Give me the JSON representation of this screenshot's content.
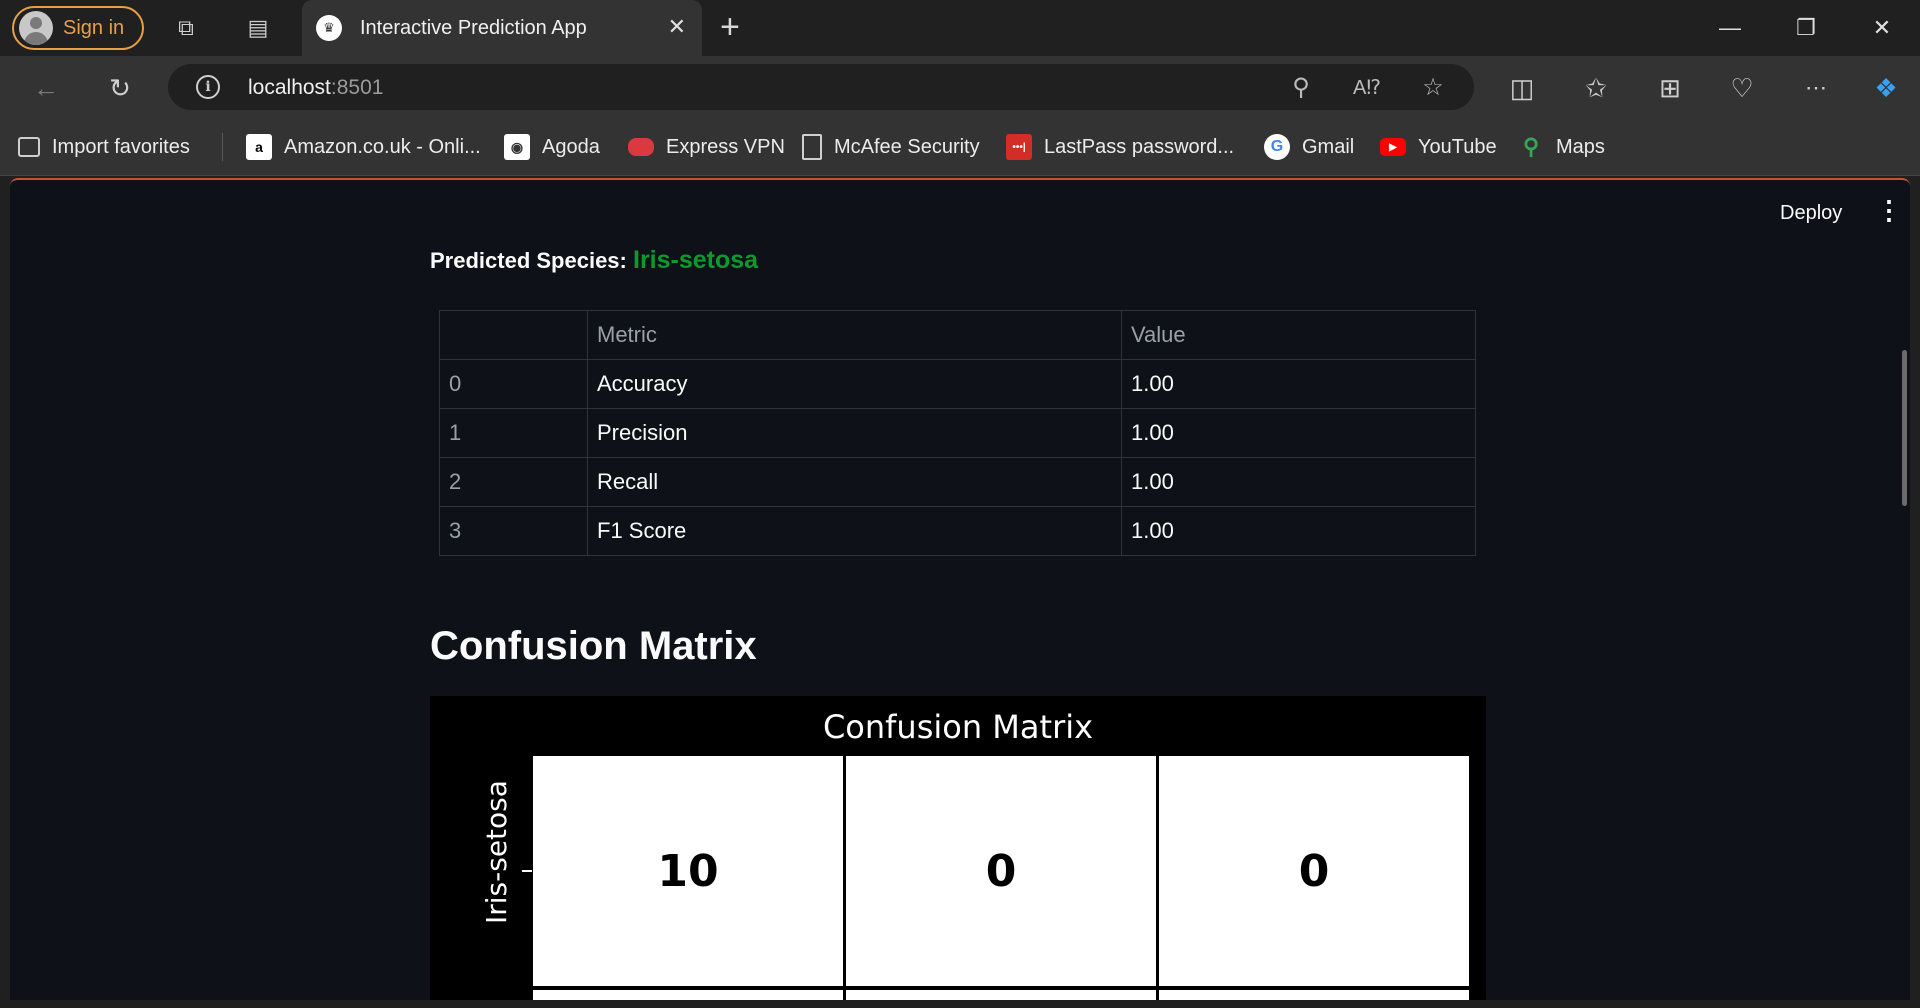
{
  "browser": {
    "signin_label": "Sign in",
    "tab_title": "Interactive Prediction App",
    "url_host": "localhost",
    "url_port": ":8501",
    "favorites": [
      {
        "label": "Import favorites",
        "icon": "import-favorites-icon"
      },
      {
        "label": "Amazon.co.uk - Onli...",
        "icon": "amazon-icon"
      },
      {
        "label": "Agoda",
        "icon": "agoda-icon"
      },
      {
        "label": "Express VPN",
        "icon": "expressvpn-icon"
      },
      {
        "label": "McAfee Security",
        "icon": "page-icon"
      },
      {
        "label": "LastPass password...",
        "icon": "lastpass-icon"
      },
      {
        "label": "Gmail",
        "icon": "google-icon"
      },
      {
        "label": "YouTube",
        "icon": "youtube-icon"
      },
      {
        "label": "Maps",
        "icon": "maps-icon"
      }
    ]
  },
  "app": {
    "deploy_label": "Deploy",
    "predicted_label": "Predicted Species:",
    "predicted_value": "Iris-setosa",
    "predicted_color": "#0d9a2c",
    "metrics_table": {
      "columns": [
        "",
        "Metric",
        "Value"
      ],
      "rows": [
        [
          "0",
          "Accuracy",
          "1.00"
        ],
        [
          "1",
          "Precision",
          "1.00"
        ],
        [
          "2",
          "Recall",
          "1.00"
        ],
        [
          "3",
          "F1 Score",
          "1.00"
        ]
      ]
    },
    "section_title": "Confusion Matrix"
  },
  "chart_data": {
    "type": "heatmap",
    "title": "Confusion Matrix",
    "y_tick_labels": [
      "Iris-setosa"
    ],
    "visible_rows": [
      {
        "label": "Iris-setosa",
        "values": [
          10,
          0,
          0
        ]
      }
    ]
  }
}
